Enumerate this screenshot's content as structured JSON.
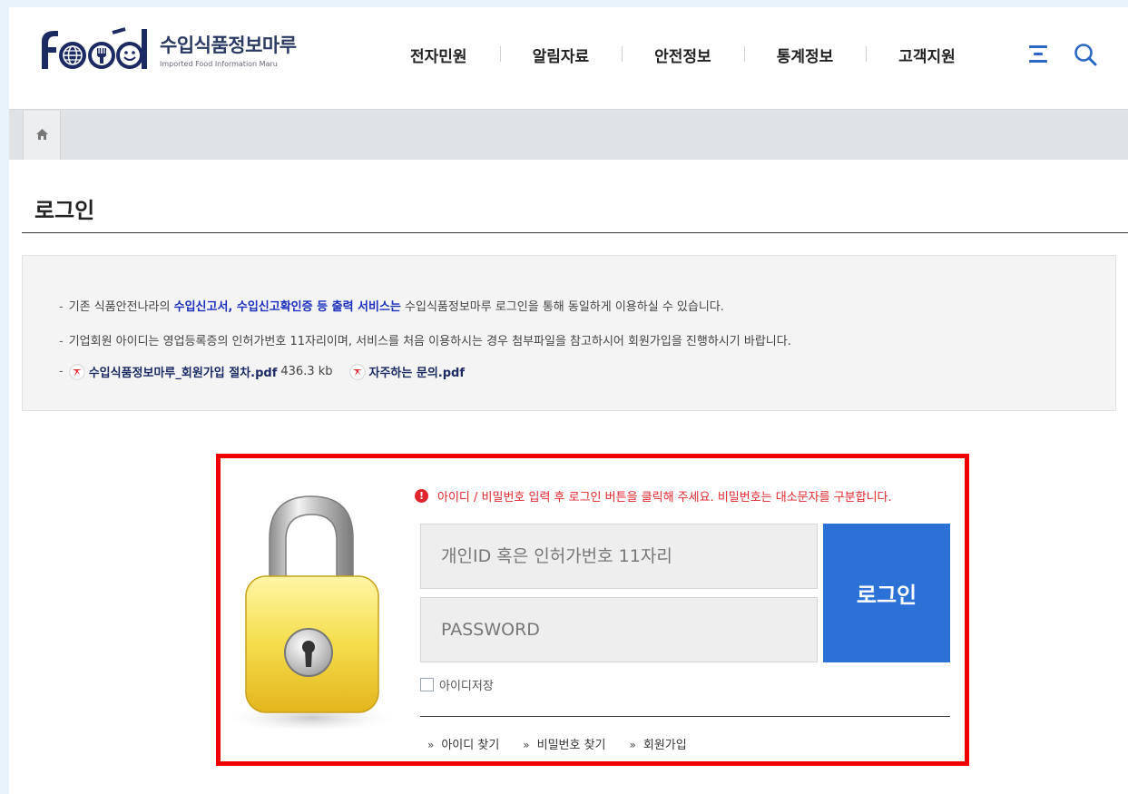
{
  "header": {
    "logo_text": "food",
    "site_name_kor": "수입식품정보마루",
    "site_name_eng": "Imported Food Information Maru",
    "nav": [
      "전자민원",
      "알림자료",
      "안전정보",
      "통계정보",
      "고객지원"
    ],
    "menu_icon": "hamburger-menu-icon",
    "search_icon": "search-icon"
  },
  "breadcrumb": {
    "home_icon": "home-icon"
  },
  "page": {
    "title": "로그인"
  },
  "notice": {
    "line1_prefix": "기존 식품안전나라의 ",
    "line1_highlight": "수입신고서, 수입신고확인증 등 출력 서비스는",
    "line1_suffix": " 수입식품정보마루 로그인을 통해 동일하게 이용하실 수 있습니다.",
    "line2": "기업회원 아이디는 영업등록증의 인허가번호 11자리이며, 서비스를 처음 이용하시는 경우 첨부파일을 참고하시어 회원가입을 진행하시기 바랍니다.",
    "files": [
      {
        "name": "수입식품정보마루_회원가입 절차.pdf",
        "size": "436.3 kb",
        "icon": "pdf-icon"
      },
      {
        "name": "자주하는 문의.pdf",
        "size": "",
        "icon": "pdf-icon"
      }
    ]
  },
  "login": {
    "lock_image": "padlock-icon",
    "warning": "아이디 / 비밀번호 입력 후 로그인 버튼을 클릭해 주세요. 비밀번호는 대소문자를 구분합니다.",
    "warning_icon": "!",
    "id_placeholder": "개인ID 혹은 인허가번호 11자리",
    "pw_placeholder": "PASSWORD",
    "button_label": "로그인",
    "save_id_label": "아이디저장",
    "save_id_checked": false,
    "links": [
      "아이디 찾기",
      "비밀번호 찾기",
      "회원가입"
    ],
    "link_arrow": "»"
  },
  "colors": {
    "brand_navy": "#1b2a62",
    "accent_blue": "#2b71d6",
    "highlight_border": "#ee0000",
    "warning_red": "#e0262d"
  }
}
